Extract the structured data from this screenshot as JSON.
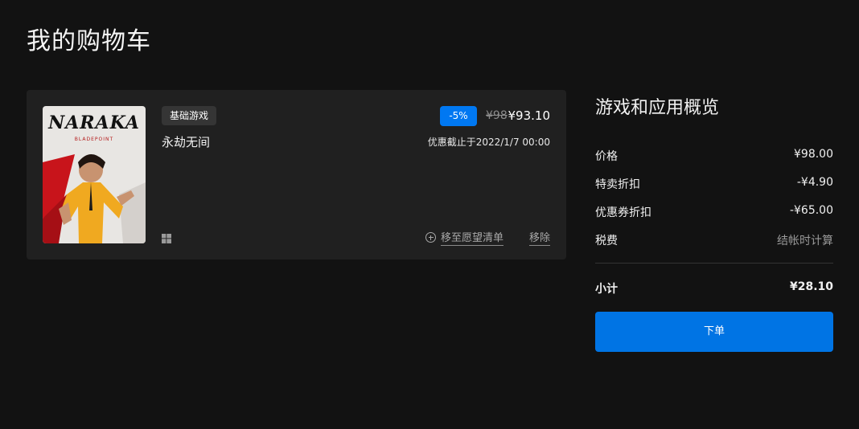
{
  "page_title": "我的购物车",
  "cart_item": {
    "badge": "基础游戏",
    "title": "永劫无间",
    "discount": "-5%",
    "price_original": "¥98",
    "price_current": "¥93.10",
    "sale_end": "优惠截止于2022/1/7 00:00",
    "platform_icon": "windows-icon",
    "wishlist_label": "移至愿望清单",
    "remove_label": "移除",
    "cover_logo": "NARAKA",
    "cover_sub": "BLADEPOINT"
  },
  "summary": {
    "title": "游戏和应用概览",
    "price_label": "价格",
    "price_value": "¥98.00",
    "sale_discount_label": "特卖折扣",
    "sale_discount_value": "-¥4.90",
    "coupon_label": "优惠券折扣",
    "coupon_value": "-¥65.00",
    "tax_label": "税费",
    "tax_value": "结帐时计算",
    "subtotal_label": "小计",
    "subtotal_value": "¥28.10",
    "checkout_label": "下单"
  },
  "colors": {
    "background": "#121212",
    "card": "#202020",
    "accent": "#0078f2"
  }
}
